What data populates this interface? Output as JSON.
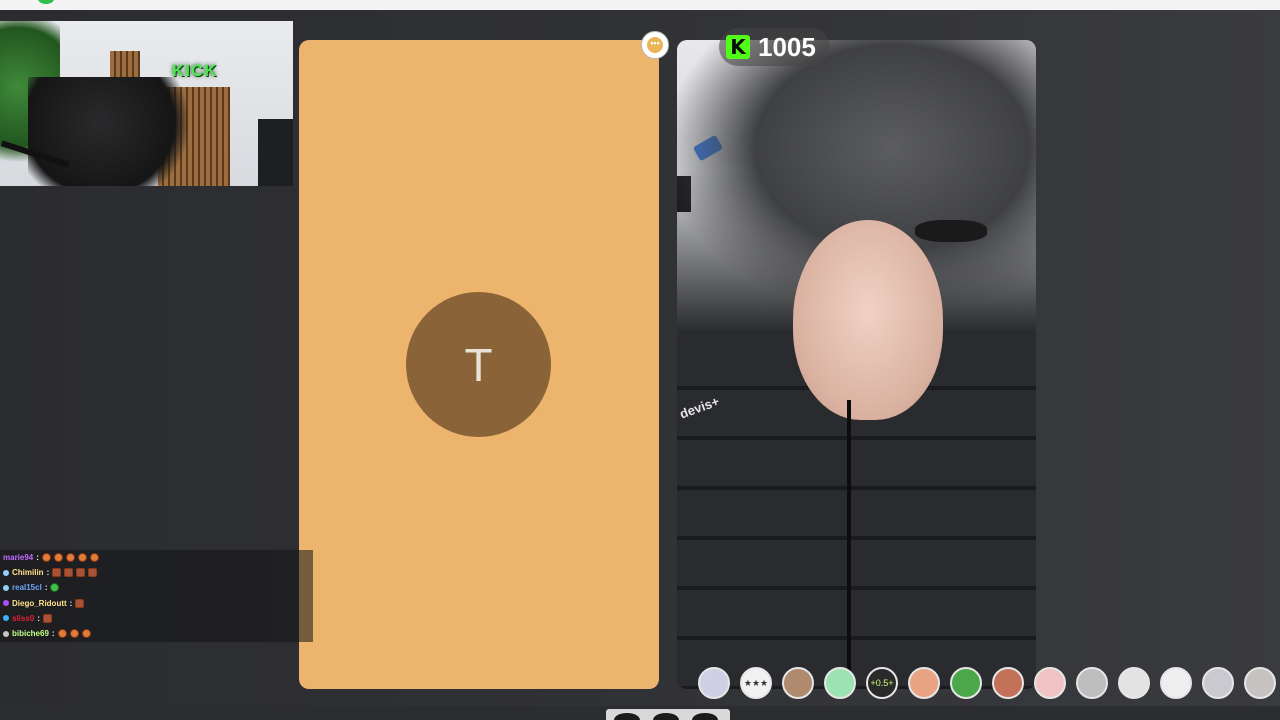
{
  "webcam": {
    "sign_text": "KICK"
  },
  "chat": {
    "messages": [
      {
        "user": "marie94",
        "color": "#c06cff",
        "sep": ":",
        "badge_color": "",
        "emotes": [
          "round",
          "round",
          "round",
          "round",
          "round"
        ]
      },
      {
        "user": "Chimilin",
        "color": "#ffe08a",
        "sep": ":",
        "badge_color": "#8fd0ff",
        "emotes": [
          "sq",
          "sq",
          "sq",
          "sq"
        ]
      },
      {
        "user": "real15cl",
        "color": "#6fa8ff",
        "sep": ":",
        "badge_color": "#8fd0ff",
        "emotes": [
          "green"
        ]
      },
      {
        "user": "Diego_Ridoutt",
        "color": "#ffe08a",
        "sep": ":",
        "badge_color": "#b04cff",
        "emotes": [
          "sq"
        ]
      },
      {
        "user": "sliss0",
        "color": "#e0223a",
        "sep": ":",
        "badge_color": "#3ab0ff",
        "emotes": [
          "sq"
        ]
      },
      {
        "user": "bibiche69",
        "color": "#c4ff8a",
        "sep": ":",
        "badge_color": "#c4c4c4",
        "emotes": [
          "round",
          "round",
          "round"
        ]
      }
    ]
  },
  "call_panel": {
    "avatar_initial": "T",
    "background_color": "#ecb46c"
  },
  "more_button": {
    "label": "•••"
  },
  "kick_counter": {
    "icon_letter": "K",
    "count": "1005",
    "accent": "#53fc18"
  },
  "video_panel": {
    "jacket_text": "devis+"
  },
  "filters": [
    {
      "name": "filter-sticker-icon",
      "label": ""
    },
    {
      "name": "filter-stars-icon",
      "label": "★★★"
    },
    {
      "name": "filter-monkey-icon",
      "label": ""
    },
    {
      "name": "filter-alien-icon",
      "label": ""
    },
    {
      "name": "filter-speed-icon",
      "label": "+0.5+"
    },
    {
      "name": "filter-face-icon",
      "label": ""
    },
    {
      "name": "filter-green-icon",
      "label": ""
    },
    {
      "name": "filter-portrait-icon",
      "label": ""
    },
    {
      "name": "filter-pink-icon",
      "label": ""
    },
    {
      "name": "filter-eyes-icon",
      "label": ""
    },
    {
      "name": "filter-sad-icon",
      "label": ""
    },
    {
      "name": "filter-smile-icon",
      "label": ""
    },
    {
      "name": "filter-gray-icon",
      "label": ""
    },
    {
      "name": "filter-cat-icon",
      "label": ""
    }
  ]
}
